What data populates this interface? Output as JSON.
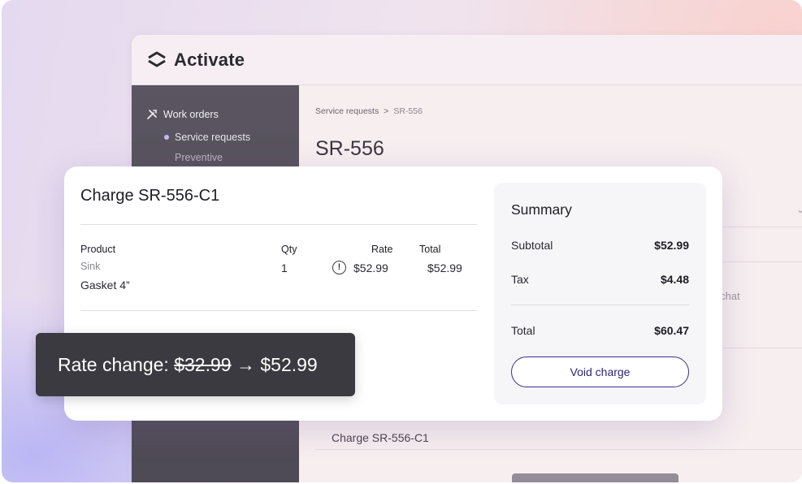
{
  "app": {
    "name": "Activate"
  },
  "sidebar": {
    "items": [
      {
        "label": "Work orders",
        "icon": "tools-icon"
      },
      {
        "label": "Service requests",
        "active": true
      },
      {
        "label": "Preventive"
      }
    ]
  },
  "breadcrumb": {
    "parent": "Service requests",
    "separator": ">",
    "current": "SR-556"
  },
  "page": {
    "title": "SR-556"
  },
  "background": {
    "chat_text": "chat",
    "charge_row": "Charge SR-556-C1"
  },
  "charge": {
    "title": "Charge SR-556-C1",
    "columns": {
      "product": "Product",
      "qty": "Qty",
      "rate": "Rate",
      "total": "Total"
    },
    "row": {
      "category": "Sink",
      "product": "Gasket 4”",
      "qty": "1",
      "rate": "$52.99",
      "total": "$52.99",
      "rate_icon": "alert-circle-icon"
    }
  },
  "summary": {
    "title": "Summary",
    "subtotal_label": "Subtotal",
    "subtotal": "$52.99",
    "tax_label": "Tax",
    "tax": "$4.48",
    "total_label": "Total",
    "total": "$60.47",
    "void_label": "Void charge"
  },
  "tooltip": {
    "prefix": "Rate change: ",
    "old_rate": "$32.99",
    "arrow": " → ",
    "new_rate": "$52.99"
  },
  "colors": {
    "accent": "#3b2f8a",
    "sidebar": "#56515c",
    "tooltip": "#3a3a40"
  }
}
